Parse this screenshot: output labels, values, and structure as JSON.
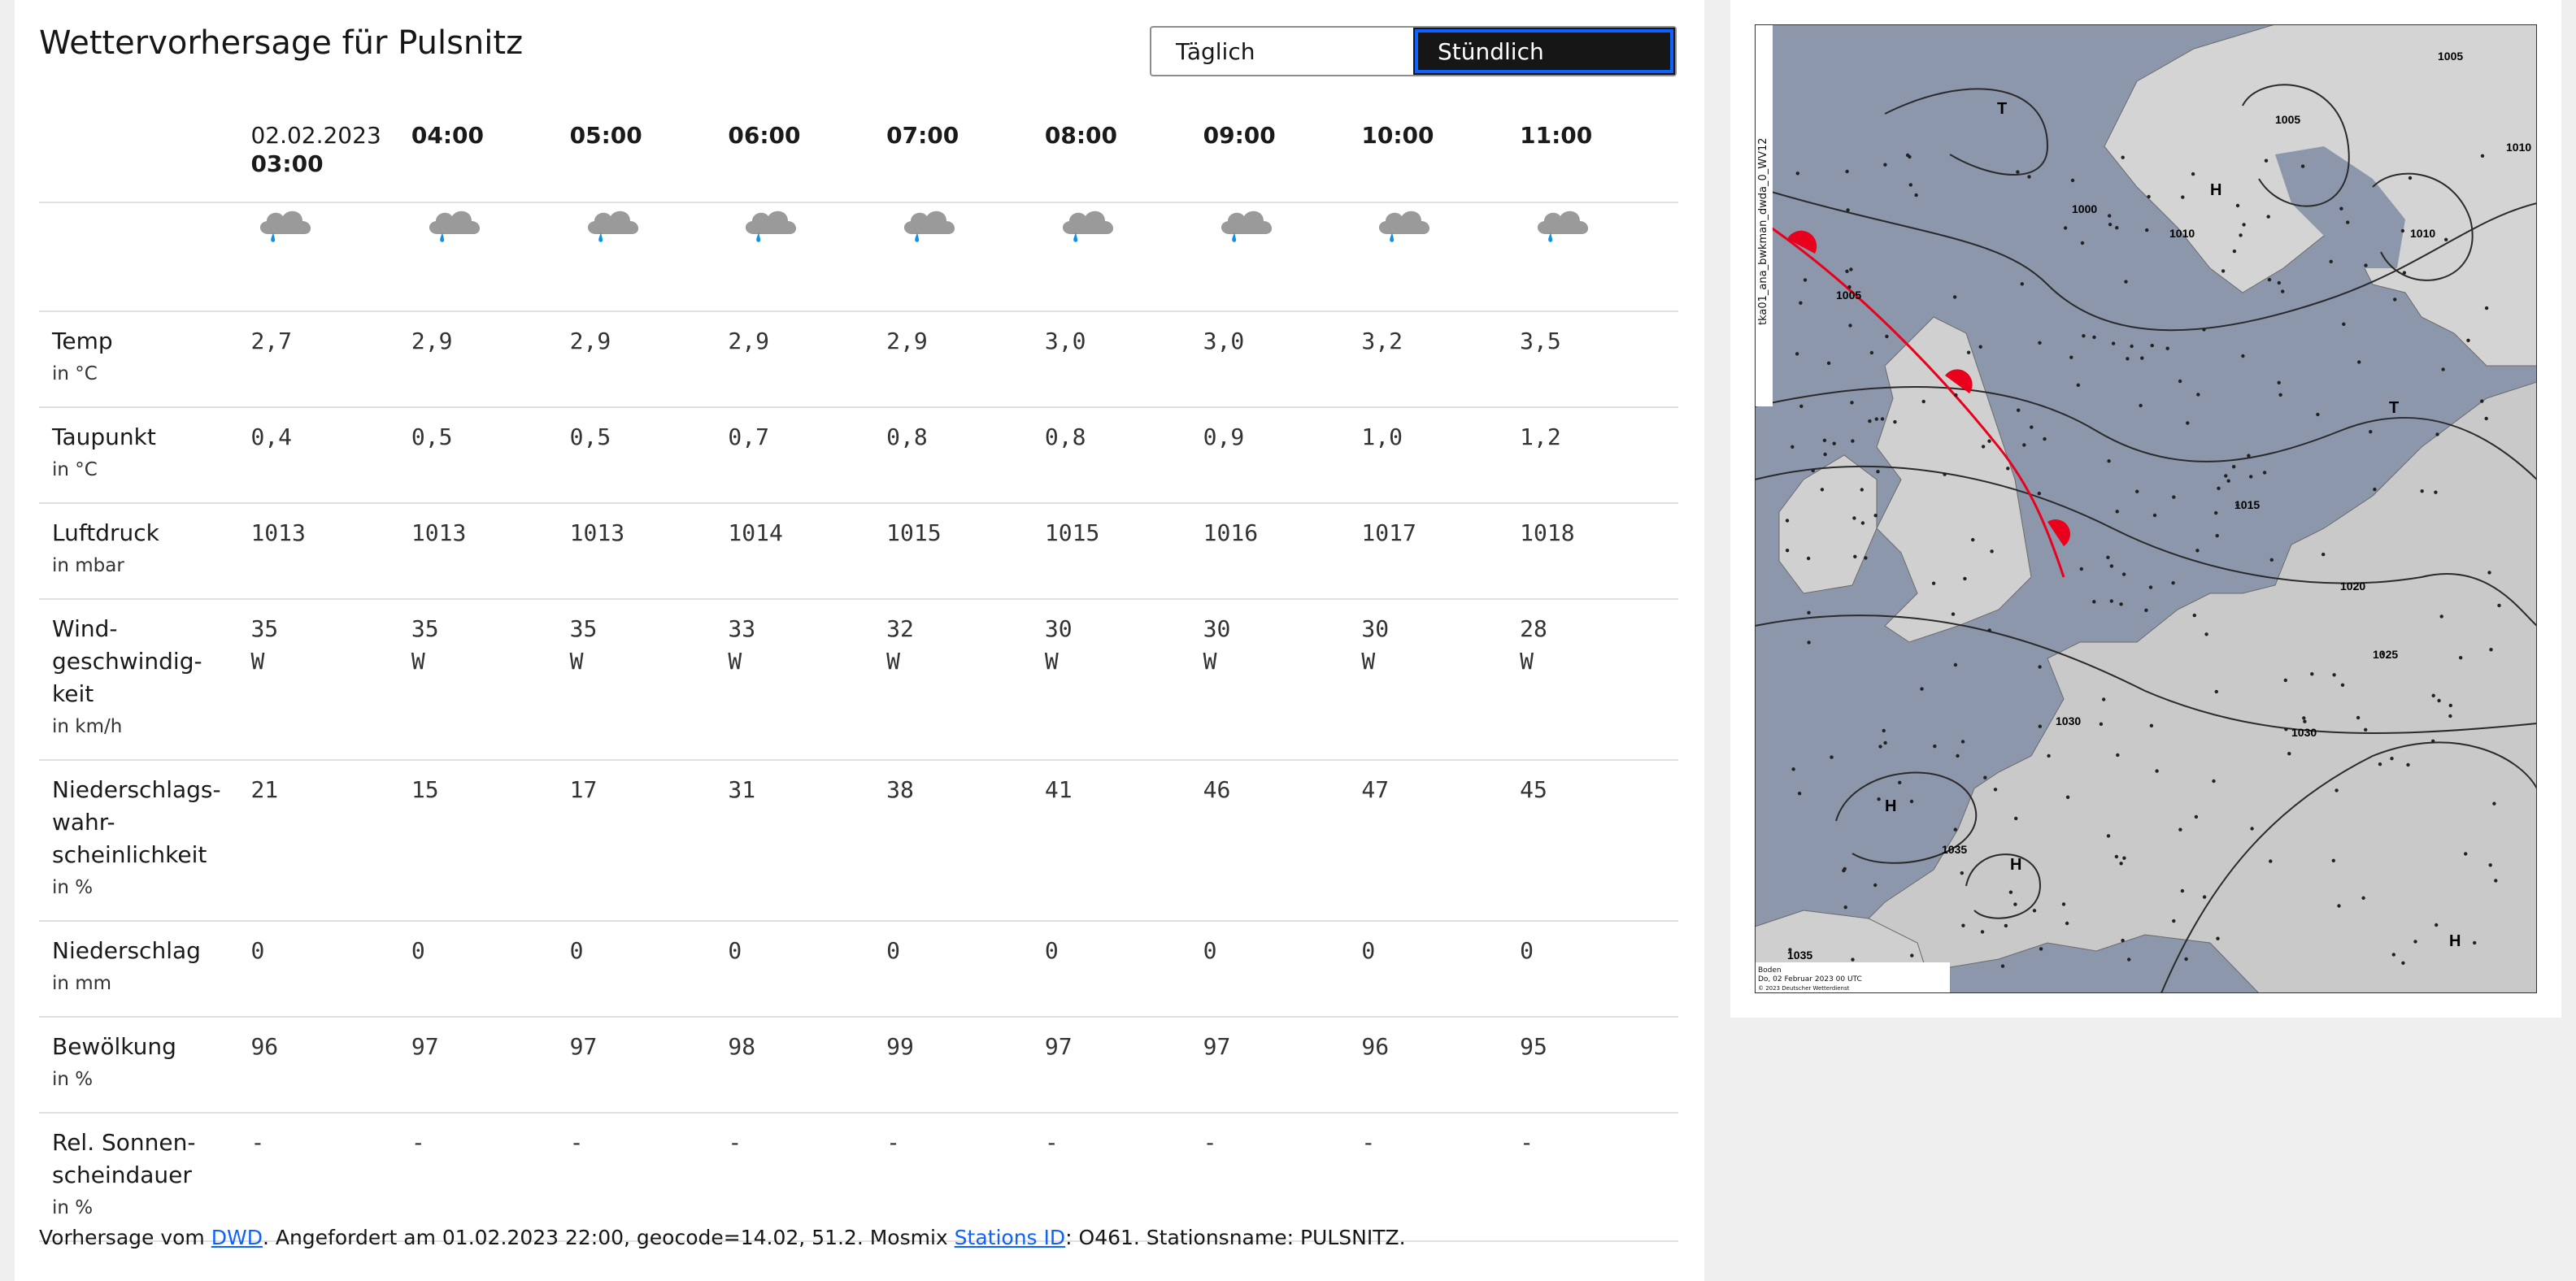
{
  "title": "Wettervorhersage für Pulsnitz",
  "toggle": {
    "daily": "Täglich",
    "hourly": "Stündlich"
  },
  "date": "02.02.2023",
  "hours": [
    "03:00",
    "04:00",
    "05:00",
    "06:00",
    "07:00",
    "08:00",
    "09:00",
    "10:00",
    "11:00"
  ],
  "icon_name": "cloud-rain-icon",
  "rows": [
    {
      "label": "Temp",
      "unit": "in °C",
      "values": [
        "2,7",
        "2,9",
        "2,9",
        "2,9",
        "2,9",
        "3,0",
        "3,0",
        "3,2",
        "3,5"
      ]
    },
    {
      "label": "Taupunkt",
      "unit": "in °C",
      "values": [
        "0,4",
        "0,5",
        "0,5",
        "0,7",
        "0,8",
        "0,8",
        "0,9",
        "1,0",
        "1,2"
      ]
    },
    {
      "label": "Luftdruck",
      "unit": "in mbar",
      "values": [
        "1013",
        "1013",
        "1013",
        "1014",
        "1015",
        "1015",
        "1016",
        "1017",
        "1018"
      ]
    },
    {
      "label": "Wind-\ngeschwindig-\nkeit",
      "unit": "in km/h",
      "values": [
        "35\nW",
        "35\nW",
        "35\nW",
        "33\nW",
        "32\nW",
        "30\nW",
        "30\nW",
        "30\nW",
        "28\nW"
      ]
    },
    {
      "label": "Niederschlags-\nwahr-\nscheinlichkeit",
      "unit": "in %",
      "values": [
        "21",
        "15",
        "17",
        "31",
        "38",
        "41",
        "46",
        "47",
        "45"
      ]
    },
    {
      "label": "Niederschlag",
      "unit": "in mm",
      "values": [
        "0",
        "0",
        "0",
        "0",
        "0",
        "0",
        "0",
        "0",
        "0"
      ]
    },
    {
      "label": "Bewölkung",
      "unit": "in %",
      "values": [
        "96",
        "97",
        "97",
        "98",
        "99",
        "97",
        "97",
        "96",
        "95"
      ]
    },
    {
      "label": "Rel. Sonnen-\nscheindauer",
      "unit": "in %",
      "values": [
        "-",
        "-",
        "-",
        "-",
        "-",
        "-",
        "-",
        "-",
        "-"
      ]
    }
  ],
  "footer": {
    "prefix": "Vorhersage vom ",
    "dwd_link": "DWD",
    "middle": ". Angefordert am 01.02.2023 22:00, geocode=14.02, 51.2. Mosmix ",
    "stations_link": "Stations ID",
    "suffix": ": O461. Stationsname: PULSNITZ."
  },
  "map": {
    "side_label": "tka01_ana_bwkman_dwda_0_WV12",
    "legend_lines": [
      "Boden",
      "Do, 02 Februar 2023 00 UTC",
      "© 2023 Deutscher Wetterdienst"
    ],
    "pressure_labels": [
      "1000",
      "1005",
      "1005",
      "1010",
      "1010",
      "1010",
      "1015",
      "1020",
      "1025",
      "1030",
      "1030",
      "1035",
      "1035",
      "1005"
    ],
    "highs_lows": [
      "T",
      "H",
      "T",
      "H",
      "H",
      "H"
    ],
    "colors": {
      "sea": "#8c97ab",
      "land": "#d4d4d4",
      "front": "#e8001c",
      "isobar": "#2a2a2a"
    }
  }
}
